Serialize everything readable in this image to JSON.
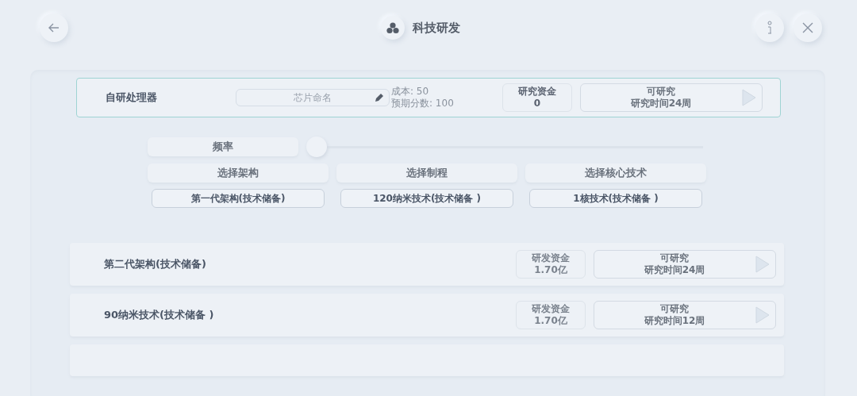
{
  "header": {
    "title": "科技研发"
  },
  "processor": {
    "name": "自研处理器",
    "name_field": {
      "placeholder": "芯片命名"
    },
    "cost": "成本: 50",
    "score": "预期分数: 100",
    "fund_label": "研究资金",
    "fund_value": "0",
    "status": "可研究",
    "time": "研究时间24周"
  },
  "frequency": {
    "label": "频率",
    "level": 0
  },
  "selectors": [
    {
      "heading": "选择架构",
      "value": "第一代架构(技术储备)"
    },
    {
      "heading": "选择制程",
      "value": "120纳米技术(技术储备 )"
    },
    {
      "heading": "选择核心技术",
      "value": "1核技术(技术储备 )"
    }
  ],
  "research_items": [
    {
      "name": "第二代架构(技术储备)",
      "fund_label": "研发资金",
      "fund_value": "1.70亿",
      "status": "可研究",
      "time": "研究时间24周"
    },
    {
      "name": "90纳米技术(技术储备 )",
      "fund_label": "研发资金",
      "fund_value": "1.70亿",
      "status": "可研究",
      "time": "研究时间12周"
    }
  ]
}
